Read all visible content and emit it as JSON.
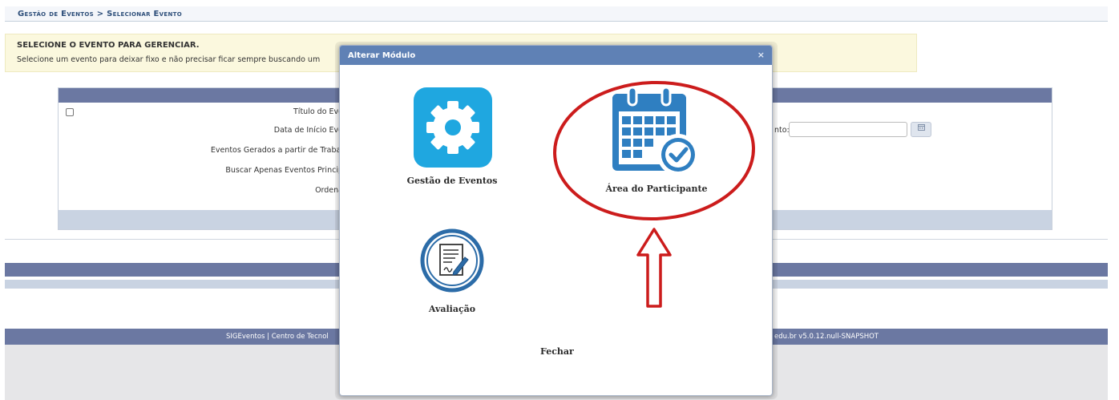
{
  "breadcrumb": {
    "text": "Gestão de Eventos > Selecionar Evento"
  },
  "info": {
    "title": "SELECIONE O EVENTO PARA GERENCIAR.",
    "text": "Selecione um evento para deixar fixo e não precisar ficar sempre buscando um"
  },
  "form": {
    "labels": {
      "titulo": "Título do Eve",
      "data_inicio": "Data de Início Eve",
      "gerados": "Eventos Gerados a partir de Trabal",
      "principais": "Buscar Apenas Eventos Princip",
      "ordena": "Ordena"
    },
    "right_label": "nto:",
    "date_value": "",
    "calendar_icon": "calendar-icon"
  },
  "footer": {
    "left": "SIGEventos | Centro de Tecnol",
    "right": "edu.br v5.0.12.null-SNAPSHOT"
  },
  "modal": {
    "title": "Alterar Módulo",
    "close": "×",
    "modules": [
      {
        "label": "Gestão de Eventos",
        "icon": "gear-icon"
      },
      {
        "label": "Área do Participante",
        "icon": "calendar-check-icon"
      },
      {
        "label": "Avaliação",
        "icon": "document-signature-icon"
      }
    ],
    "fechar": "Fechar"
  },
  "colors": {
    "header_band": "#6b78a2",
    "modal_title": "#5f81b5",
    "gear_tile": "#1fa7e0",
    "calendar": "#2f7fc1",
    "annotation": "#cc1c1c"
  }
}
